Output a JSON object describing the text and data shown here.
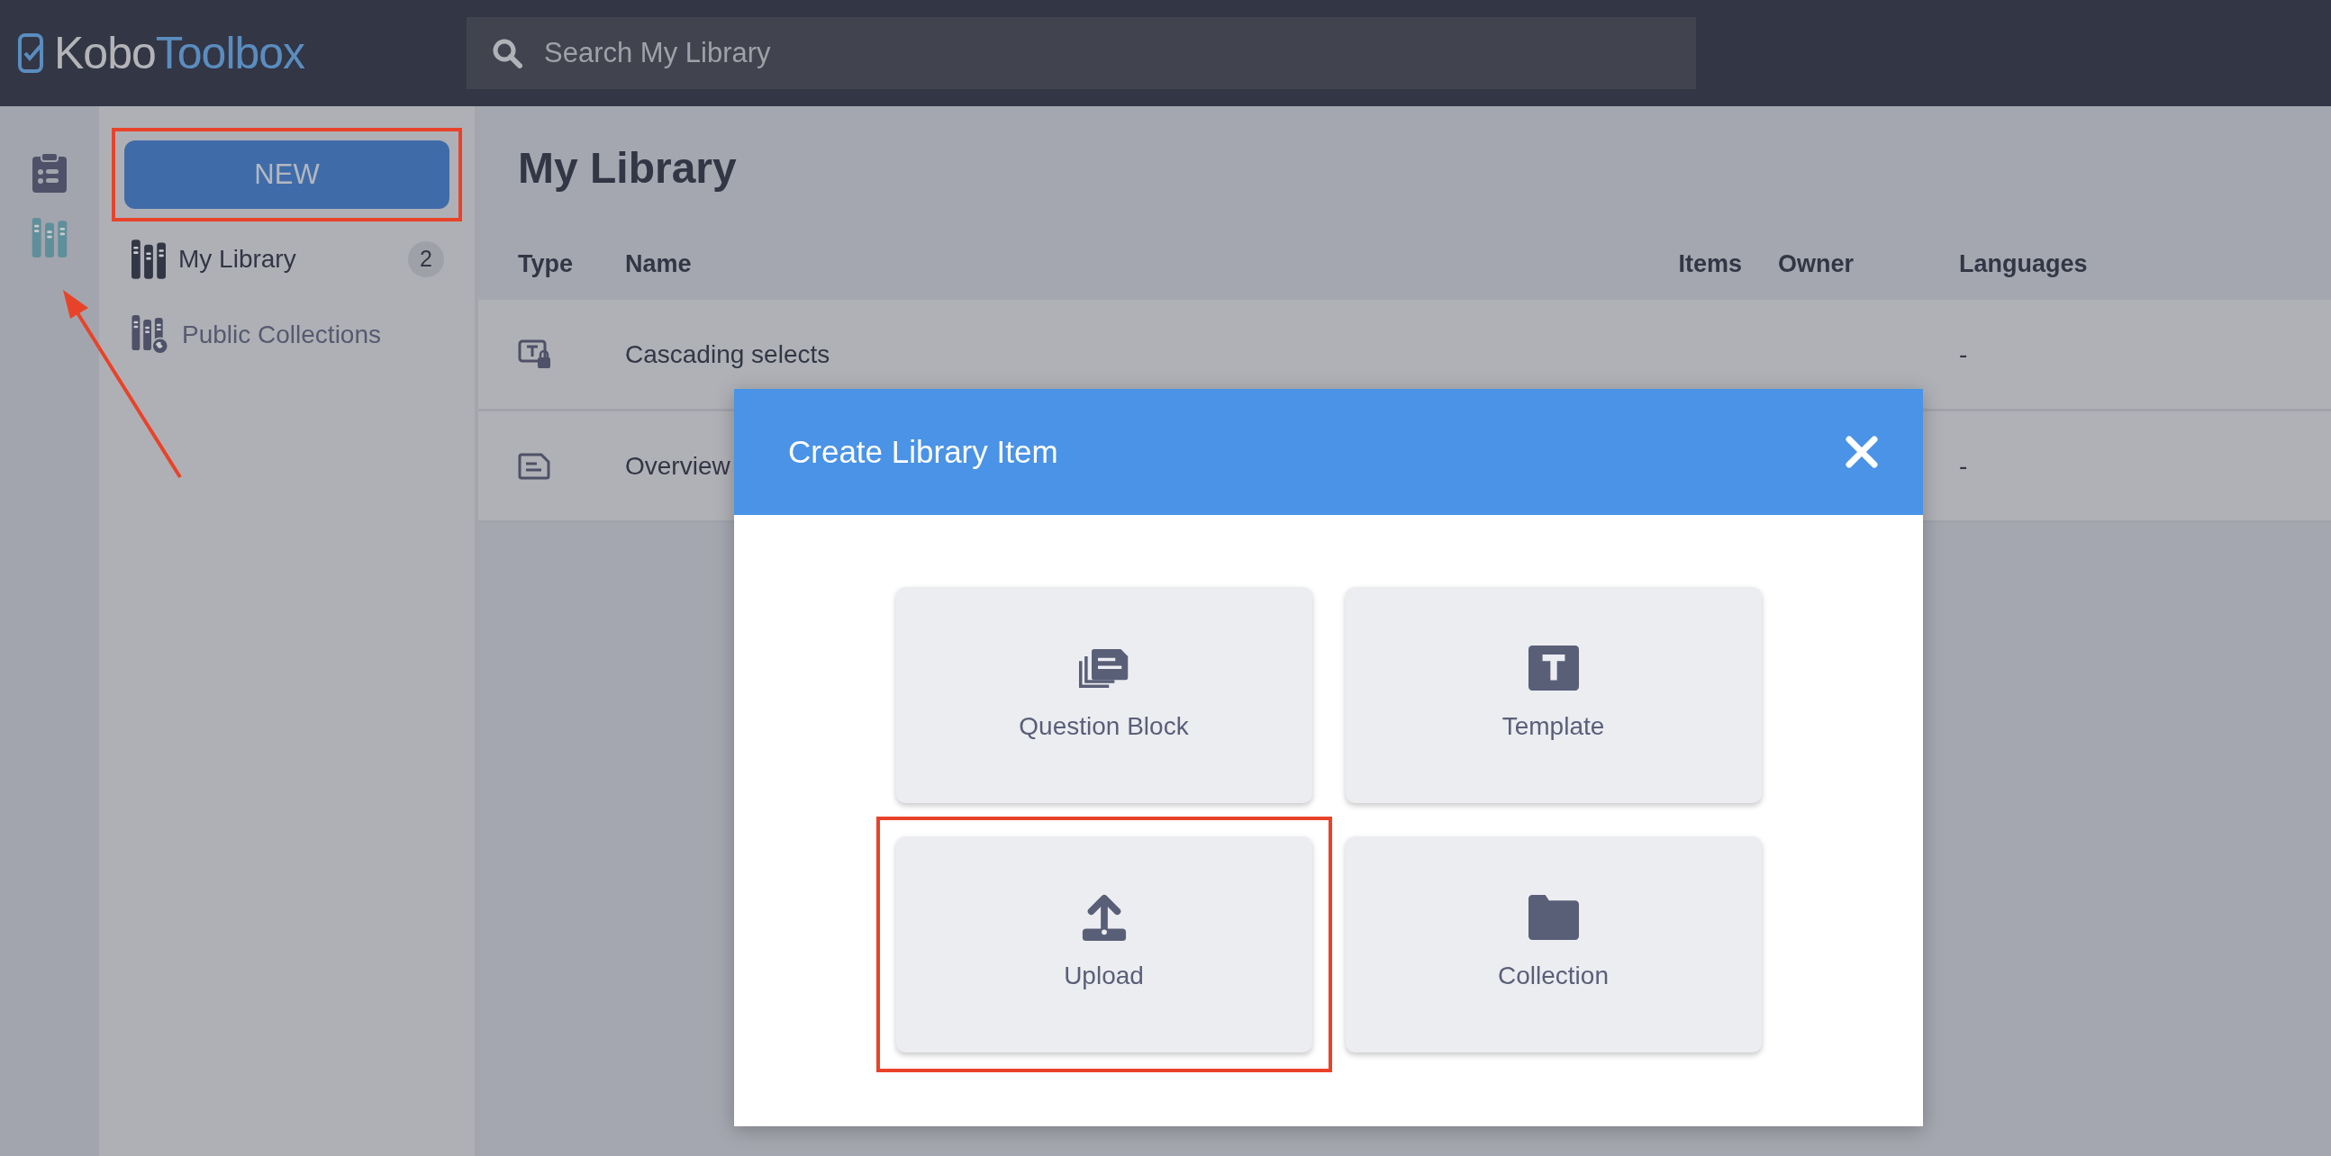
{
  "header": {
    "logo": {
      "first": "Kobo",
      "second": "Toolbox"
    },
    "search": {
      "placeholder": "Search My Library"
    }
  },
  "rail": [
    {
      "kind": "forms",
      "selected": false
    },
    {
      "kind": "library",
      "selected": true
    }
  ],
  "sidebar": {
    "new_button": {
      "label": "NEW",
      "highlighted": true
    },
    "items": [
      {
        "kind": "library",
        "label": "My Library",
        "count": "2",
        "selected": true
      },
      {
        "kind": "public",
        "label": "Public Collections",
        "selected": false
      }
    ]
  },
  "main": {
    "title": "My Library",
    "columns": [
      "Type",
      "Name",
      "Items",
      "Owner",
      "Languages"
    ],
    "rows": [
      {
        "kind": "template-locked",
        "name": "Cascading selects",
        "languages": "-"
      },
      {
        "kind": "block",
        "name": "Overview",
        "languages": "-"
      }
    ]
  },
  "dialog": {
    "title": "Create Library Item",
    "options": [
      {
        "kind": "block",
        "label": "Question Block",
        "highlighted": false
      },
      {
        "kind": "template",
        "label": "Template",
        "highlighted": false
      },
      {
        "kind": "upload",
        "label": "Upload",
        "highlighted": true
      },
      {
        "kind": "collection",
        "label": "Collection",
        "highlighted": false
      }
    ]
  }
}
